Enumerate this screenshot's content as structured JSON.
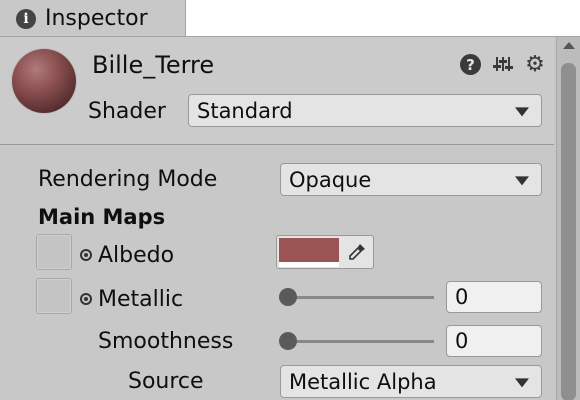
{
  "tab": {
    "icon": "info-icon",
    "title": "Inspector"
  },
  "header": {
    "material_name": "Bille_Terre",
    "preview": "material-sphere-preview",
    "icons": [
      "help-icon",
      "presets-icon",
      "gear-icon"
    ],
    "shader_label": "Shader",
    "shader_value": "Standard"
  },
  "body": {
    "rendering_mode_label": "Rendering Mode",
    "rendering_mode_value": "Opaque",
    "main_maps_heading": "Main Maps",
    "albedo": {
      "label": "Albedo",
      "color": "#9a5454"
    },
    "metallic": {
      "label": "Metallic",
      "value": "0",
      "slider_fraction": 0
    },
    "smoothness": {
      "label": "Smoothness",
      "value": "0",
      "slider_fraction": 0
    },
    "source": {
      "label": "Source",
      "value": "Metallic Alpha"
    }
  },
  "colors": {
    "panel_bg": "#c8c8c8",
    "field_bg": "#e4e4e4",
    "albedo_swatch": "#9a5454"
  }
}
